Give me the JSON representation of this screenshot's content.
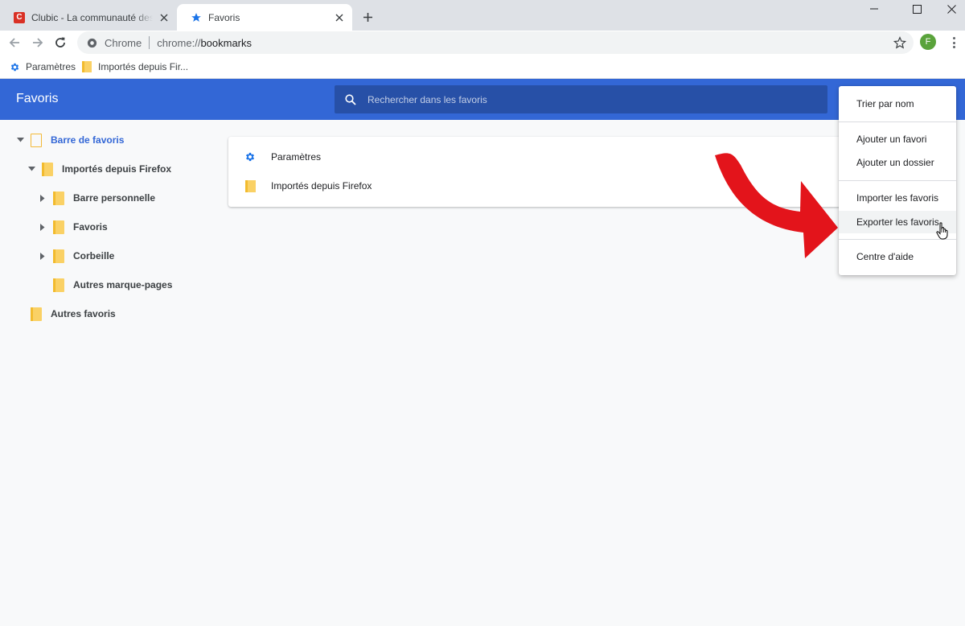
{
  "tabs": [
    {
      "title": "Clubic - La communauté des passionnés de high-tech",
      "favicon": "C"
    },
    {
      "title": "Favoris"
    }
  ],
  "omnibox": {
    "scheme": "Chrome",
    "url_prefix": "chrome://",
    "url_host": "bookmarks"
  },
  "profile": {
    "initial": "F",
    "color": "#5aa33b"
  },
  "bookmarks_bar": [
    {
      "label": "Paramètres",
      "icon": "gear-icon"
    },
    {
      "label": "Importés depuis Fir...",
      "icon": "folder-icon"
    }
  ],
  "page": {
    "title": "Favoris",
    "search_placeholder": "Rechercher dans les favoris"
  },
  "tree": [
    {
      "label": "Barre de favoris",
      "expanded": true,
      "selected": true
    },
    {
      "label": "Importés depuis Firefox",
      "expanded": true
    },
    {
      "label": "Barre personnelle",
      "expanded": false
    },
    {
      "label": "Favoris",
      "expanded": false
    },
    {
      "label": "Corbeille",
      "expanded": false
    },
    {
      "label": "Autres marque-pages"
    },
    {
      "label": "Autres favoris"
    }
  ],
  "items": [
    {
      "label": "Paramètres",
      "icon": "gear-icon"
    },
    {
      "label": "Importés depuis Firefox",
      "icon": "folder-icon"
    }
  ],
  "menu": [
    {
      "label": "Trier par nom"
    },
    {
      "label": "Ajouter un favori"
    },
    {
      "label": "Ajouter un dossier"
    },
    {
      "label": "Importer les favoris"
    },
    {
      "label": "Exporter les favoris",
      "hovered": true
    },
    {
      "label": "Centre d'aide"
    }
  ],
  "colors": {
    "header": "#3367d6",
    "annotation_arrow": "#e3141b",
    "folder": "#fad165"
  }
}
